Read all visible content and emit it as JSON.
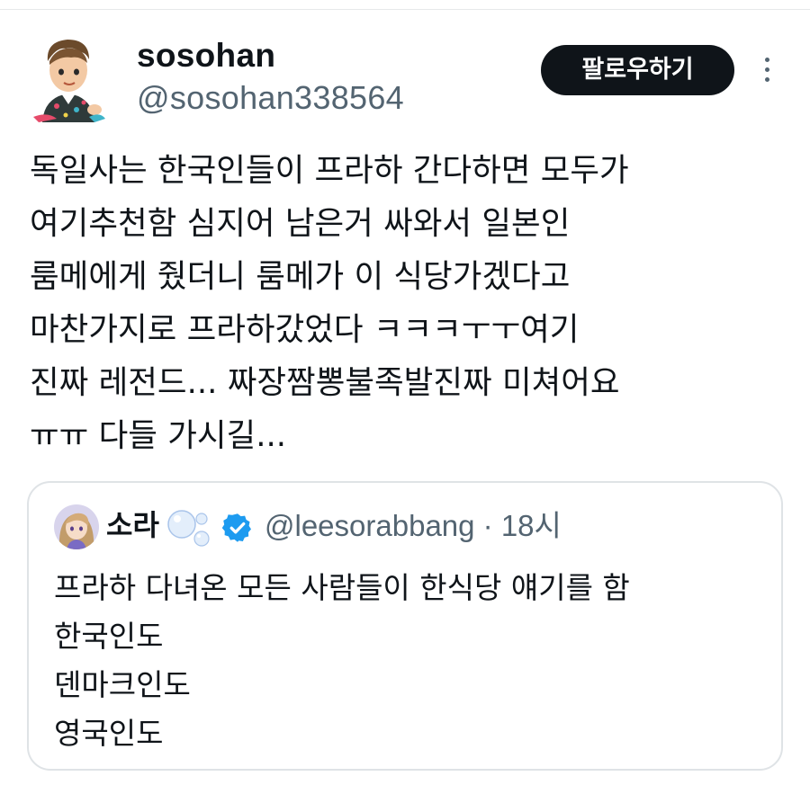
{
  "author": {
    "display_name": "sosohan",
    "handle": "@sosohan338564",
    "avatar_icon": "cartoon-avatar-icon"
  },
  "follow_button": {
    "label": "팔로우하기"
  },
  "more_menu": {
    "icon": "more-vertical-icon"
  },
  "tweet": {
    "text": "독일사는 한국인들이 프라하 간다하면 모두가\n여기추천함 심지어 남은거 싸와서 일본인\n룸메에게 줬더니 룸메가 이 식당가겠다고\n마찬가지로 프라하갔었다 ㅋㅋㅋㅜㅜ여기\n진짜 레전드... 짜장짬뽕불족발진짜 미쳐어요\nㅠㅠ 다들 가시길..."
  },
  "quoted_tweet": {
    "display_name": "소라",
    "handle": "@leesorabbang",
    "separator": " · ",
    "time": "18시",
    "verified": true,
    "accent_color": "#1d9bf0",
    "text": "프라하 다녀온 모든 사람들이 한식당 얘기를 함\n한국인도\n덴마크인도\n영국인도"
  }
}
